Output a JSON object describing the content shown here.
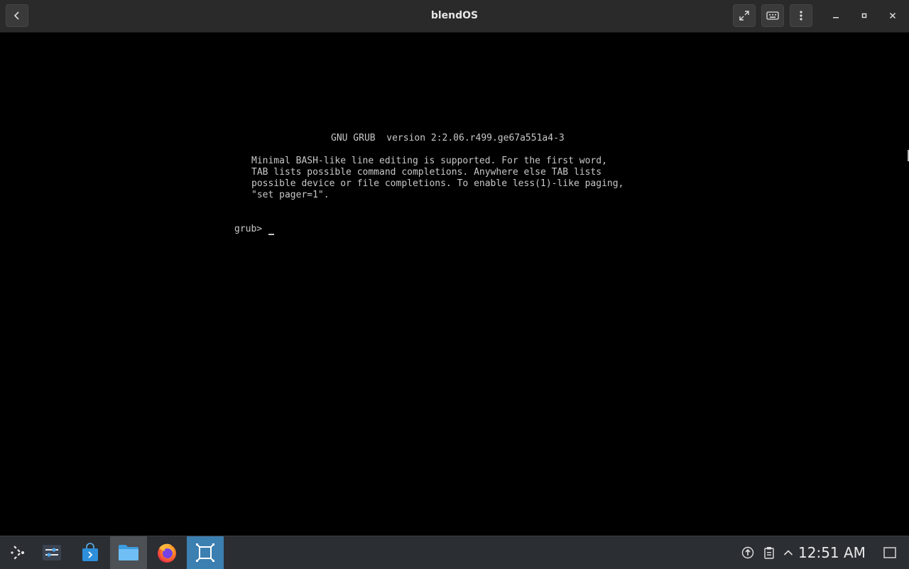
{
  "window": {
    "title": "blendOS",
    "buttons": [
      "back-icon",
      "fullscreen-icon",
      "keyboard-icon",
      "more-vertical-icon",
      "minimize-icon",
      "maximize-icon",
      "close-icon"
    ]
  },
  "console": {
    "header": "GNU GRUB  version 2:2.06.r499.ge67a551a4-3",
    "help_lines": [
      "Minimal BASH-like line editing is supported. For the first word,",
      "TAB lists possible command completions. Anywhere else TAB lists",
      "possible device or file completions. To enable less(1)-like paging,",
      "\"set pager=1\"."
    ],
    "prompt": "grub> "
  },
  "taskbar": {
    "apps": [
      {
        "icon": "application-launcher-icon",
        "state": "normal"
      },
      {
        "icon": "system-settings-icon",
        "state": "normal"
      },
      {
        "icon": "software-store-icon",
        "state": "normal"
      },
      {
        "icon": "file-manager-icon",
        "state": "active"
      },
      {
        "icon": "firefox-icon",
        "state": "normal"
      },
      {
        "icon": "virtual-machine-icon",
        "state": "focused"
      }
    ],
    "tray": [
      "update-notifier-icon",
      "clipboard-icon",
      "expand-tray-icon",
      "show-desktop-icon"
    ],
    "clock": "12:51 AM"
  },
  "colors": {
    "titlebar": "#2a2a2a",
    "console_bg": "#000000",
    "console_text": "#c8c8c8",
    "taskbar": "#2b2e33",
    "focused_task": "#3c7fb1"
  }
}
